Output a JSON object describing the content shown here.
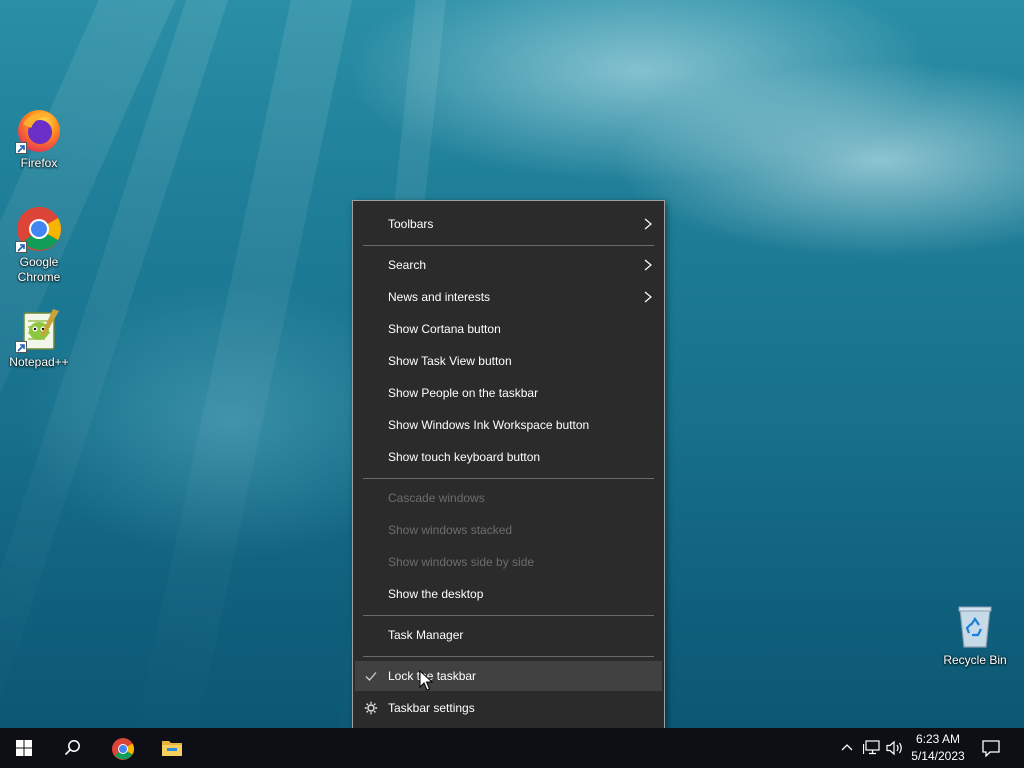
{
  "desktop": {
    "icons": [
      {
        "label": "Firefox"
      },
      {
        "label": "Google Chrome"
      },
      {
        "label": "Notepad++"
      },
      {
        "label": "Recycle Bin"
      }
    ]
  },
  "context_menu": {
    "items": [
      {
        "label": "Toolbars",
        "submenu": true,
        "enabled": true
      },
      {
        "label": "Search",
        "submenu": true,
        "enabled": true
      },
      {
        "label": "News and interests",
        "submenu": true,
        "enabled": true
      },
      {
        "label": "Show Cortana button",
        "enabled": true
      },
      {
        "label": "Show Task View button",
        "enabled": true
      },
      {
        "label": "Show People on the taskbar",
        "enabled": true
      },
      {
        "label": "Show Windows Ink Workspace button",
        "enabled": true
      },
      {
        "label": "Show touch keyboard button",
        "enabled": true
      },
      {
        "label": "Cascade windows",
        "enabled": false
      },
      {
        "label": "Show windows stacked",
        "enabled": false
      },
      {
        "label": "Show windows side by side",
        "enabled": false
      },
      {
        "label": "Show the desktop",
        "enabled": true
      },
      {
        "label": "Task Manager",
        "enabled": true
      },
      {
        "label": "Lock the taskbar",
        "enabled": true,
        "checked": true,
        "hovered": true
      },
      {
        "label": "Taskbar settings",
        "enabled": true,
        "icon": "gear-icon"
      }
    ]
  },
  "taskbar": {
    "pinned": [
      "start-icon",
      "search-icon",
      "chrome-icon",
      "file-explorer-icon"
    ],
    "tray_icons": [
      "chevron-up-icon",
      "network-icon",
      "volume-icon",
      "notifications-icon"
    ],
    "clock": {
      "time": "6:23 AM",
      "date": "5/14/2023"
    }
  },
  "colors": {
    "menu_background": "#2b2b2b",
    "menu_border": "#a0a0a0",
    "menu_hover": "#414141",
    "menu_disabled_text": "#6d6d6d",
    "taskbar": "#0d0f14",
    "windows_blue": "#00a4ef"
  }
}
